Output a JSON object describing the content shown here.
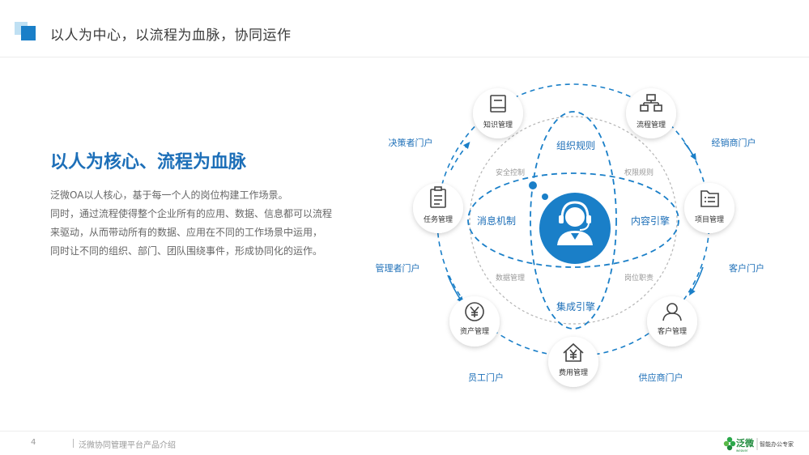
{
  "header": {
    "title": "以人为中心，以流程为血脉，协同运作"
  },
  "content": {
    "headline": "以人为核心、流程为血脉",
    "paragraph_lines": [
      "泛微OA以人核心，基于每一个人的岗位构建工作场景。",
      "同时，通过流程使得整个企业所有的应用、数据、信息都可以流程",
      "来驱动，从而带动所有的数据、应用在不同的工作场景中运用，",
      "同时让不同的组织、部门、团队围绕事件，形成协同化的运作。"
    ]
  },
  "diagram": {
    "nodes": {
      "knowledge": {
        "label": "知识管理",
        "icon": "book-icon"
      },
      "process": {
        "label": "流程管理",
        "icon": "org-chart-icon"
      },
      "task": {
        "label": "任务管理",
        "icon": "clipboard-icon"
      },
      "project": {
        "label": "项目管理",
        "icon": "folder-list-icon"
      },
      "asset": {
        "label": "资产管理",
        "icon": "yen-circle-icon"
      },
      "customer": {
        "label": "客户管理",
        "icon": "person-icon"
      },
      "expense": {
        "label": "费用管理",
        "icon": "yen-house-icon"
      }
    },
    "portals": {
      "decision": "决策者门户",
      "distributor": "经销商门户",
      "manager": "管理者门户",
      "client": "客户门户",
      "staff": "员工门户",
      "supplier": "供应商门户"
    },
    "inner": {
      "org_rules": "组织规则",
      "messaging": "消息机制",
      "content_engine": "内容引擎",
      "integration_engine": "集成引擎",
      "security": "安全控制",
      "permissions": "权限规则",
      "data_management": "数据管理",
      "job_duties": "岗位职责"
    },
    "center_icon": "customer-service-person-icon",
    "accent_color": "#1a7fc8"
  },
  "footer": {
    "page_number": "4",
    "caption": "泛微协同管理平台产品介绍",
    "brand_name": "泛微",
    "brand_sub": "weaver",
    "brand_slogan": "智能办公专家"
  }
}
